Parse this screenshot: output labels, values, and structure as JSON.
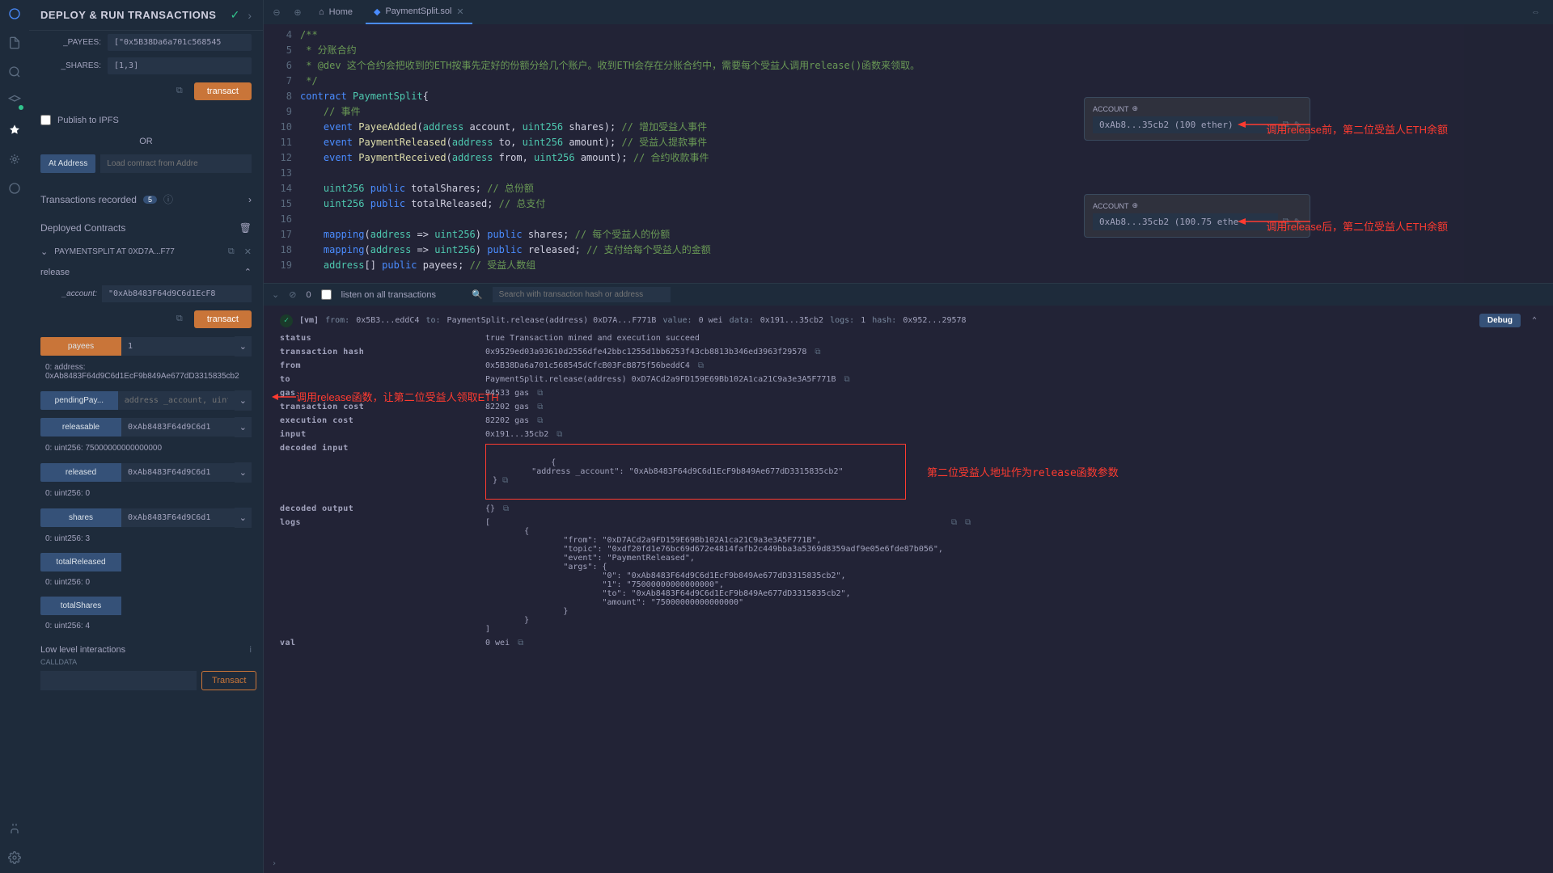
{
  "sidepanel": {
    "title": "DEPLOY & RUN TRANSACTIONS",
    "payees": {
      "label": "_PAYEES:",
      "value": "[\"0x5B38Da6a701c568545"
    },
    "shares": {
      "label": "_SHARES:",
      "value": "[1,3]"
    },
    "transact": "transact",
    "publish": "Publish to IPFS",
    "or": "OR",
    "at_address": "At Address",
    "load_placeholder": "Load contract from Addre",
    "tx_recorded": "Transactions recorded",
    "tx_recorded_count": "5",
    "deployed": "Deployed Contracts",
    "contract_name": "PAYMENTSPLIT AT 0XD7A...F77",
    "release": {
      "name": "release",
      "account_label": "_account:",
      "account_value": "\"0xAb8483F64d9C6d1EcF8",
      "transact": "transact"
    },
    "payees_btn": {
      "label": "payees",
      "val": "1",
      "result": "0:  address: 0xAb8483F64d9C6d1EcF9b849Ae677dD3315835cb2"
    },
    "pendingPay": {
      "label": "pendingPay...",
      "placeholder": "address _account, uint"
    },
    "releasable": {
      "label": "releasable",
      "val": "0xAb8483F64d9C6d1",
      "result": "0: uint256: 75000000000000000"
    },
    "released": {
      "label": "released",
      "val": "0xAb8483F64d9C6d1",
      "result": "0: uint256: 0"
    },
    "shares_btn": {
      "label": "shares",
      "val": "0xAb8483F64d9C6d1",
      "result": "0: uint256: 3"
    },
    "totalReleased": {
      "label": "totalReleased",
      "result": "0: uint256: 0"
    },
    "totalShares": {
      "label": "totalShares",
      "result": "0: uint256: 4"
    },
    "lowlevel": "Low level interactions",
    "calldata": "CALLDATA",
    "transact_outline": "Transact"
  },
  "tabs": {
    "home": "Home",
    "file": "PaymentSplit.sol"
  },
  "code_lines": [
    {
      "n": 4,
      "html": "<span class='cmt'>/**</span>"
    },
    {
      "n": 5,
      "html": "<span class='cmt'> * 分账合约</span>"
    },
    {
      "n": 6,
      "html": "<span class='cmt'> * @dev 这个合约会把收到的ETH按事先定好的份额分给几个账户。收到ETH会存在分账合约中，需要每个受益人调用release()函数来领取。</span>"
    },
    {
      "n": 7,
      "html": "<span class='cmt'> */</span>"
    },
    {
      "n": 8,
      "html": "<span class='kw'>contract</span> <span class='type'>PaymentSplit</span>{"
    },
    {
      "n": 9,
      "html": "    <span class='cmt'>// 事件</span>"
    },
    {
      "n": 10,
      "html": "    <span class='kw'>event</span> <span class='fn'>PayeeAdded</span>(<span class='type'>address</span> account, <span class='type'>uint256</span> shares); <span class='cmt'>// 增加受益人事件</span>"
    },
    {
      "n": 11,
      "html": "    <span class='kw'>event</span> <span class='fn'>PaymentReleased</span>(<span class='type'>address</span> to, <span class='type'>uint256</span> amount); <span class='cmt'>// 受益人提款事件</span>"
    },
    {
      "n": 12,
      "html": "    <span class='kw'>event</span> <span class='fn'>PaymentReceived</span>(<span class='type'>address</span> from, <span class='type'>uint256</span> amount); <span class='cmt'>// 合约收款事件</span>"
    },
    {
      "n": 13,
      "html": ""
    },
    {
      "n": 14,
      "html": "    <span class='type'>uint256</span> <span class='kw'>public</span> totalShares; <span class='cmt'>// 总份额</span>"
    },
    {
      "n": 15,
      "html": "    <span class='type'>uint256</span> <span class='kw'>public</span> totalReleased; <span class='cmt'>// 总支付</span>"
    },
    {
      "n": 16,
      "html": ""
    },
    {
      "n": 17,
      "html": "    <span class='kw'>mapping</span>(<span class='type'>address</span> => <span class='type'>uint256</span>) <span class='kw'>public</span> shares; <span class='cmt'>// 每个受益人的份额</span>"
    },
    {
      "n": 18,
      "html": "    <span class='kw'>mapping</span>(<span class='type'>address</span> => <span class='type'>uint256</span>) <span class='kw'>public</span> released; <span class='cmt'>// 支付给每个受益人的金额</span>"
    },
    {
      "n": 19,
      "html": "    <span class='type'>address</span>[] <span class='kw'>public</span> payees; <span class='cmt'>// 受益人数组</span>"
    }
  ],
  "accounts": {
    "label": "ACCOUNT",
    "before": "0xAb8...35cb2 (100 ether)",
    "after": "0xAb8...35cb2 (100.75 ethe"
  },
  "annotations": {
    "release_call": "调用release函数，让第二位受益人领取ETH",
    "before": "调用release前，第二位受益人ETH余额",
    "after": "调用release后，第二位受益人ETH余额",
    "decoded": "第二位受益人地址作为release函数参数"
  },
  "term_toolbar": {
    "count": "0",
    "listen": "listen on all transactions",
    "search_placeholder": "Search with transaction hash or address"
  },
  "tx": {
    "vm": "[vm]",
    "from_k": "from:",
    "from_v": "0x5B3...eddC4",
    "to_k": "to:",
    "to_v": "PaymentSplit.release(address) 0xD7A...F771B",
    "value_k": "value:",
    "value_v": "0 wei",
    "data_k": "data:",
    "data_v": "0x191...35cb2",
    "logs_k": "logs:",
    "logs_v": "1",
    "hash_k": "hash:",
    "hash_v": "0x952...29578",
    "debug": "Debug"
  },
  "kv": {
    "status": {
      "k": "status",
      "v": "true Transaction mined and execution succeed"
    },
    "txhash": {
      "k": "transaction hash",
      "v": "0x9529ed03a93610d2556dfe42bbc1255d1bb6253f43cb8813b346ed3963f29578"
    },
    "from": {
      "k": "from",
      "v": "0x5B38Da6a701c568545dCfcB03FcB875f56beddC4"
    },
    "to": {
      "k": "to",
      "v": "PaymentSplit.release(address) 0xD7ACd2a9FD159E69Bb102A1ca21C9a3e3A5F771B"
    },
    "gas": {
      "k": "gas",
      "v": "94533 gas"
    },
    "txcost": {
      "k": "transaction cost",
      "v": "82202 gas"
    },
    "execost": {
      "k": "execution cost",
      "v": "82202 gas"
    },
    "input": {
      "k": "input",
      "v": "0x191...35cb2"
    },
    "decinput": {
      "k": "decoded input",
      "v": "{\n        \"address _account\": \"0xAb8483F64d9C6d1EcF9b849Ae677dD3315835cb2\"\n}"
    },
    "decoutput": {
      "k": "decoded output",
      "v": "{}"
    },
    "logs": {
      "k": "logs",
      "v": "[\n        {\n                \"from\": \"0xD7ACd2a9FD159E69Bb102A1ca21C9a3e3A5F771B\",\n                \"topic\": \"0xdf20fd1e76bc69d672e4814fafb2c449bba3a5369d8359adf9e05e6fde87b056\",\n                \"event\": \"PaymentReleased\",\n                \"args\": {\n                        \"0\": \"0xAb8483F64d9C6d1EcF9b849Ae677dD3315835cb2\",\n                        \"1\": \"75000000000000000\",\n                        \"to\": \"0xAb8483F64d9C6d1EcF9b849Ae677dD3315835cb2\",\n                        \"amount\": \"75000000000000000\"\n                }\n        }\n]"
    },
    "val": {
      "k": "val",
      "v": "0 wei"
    }
  }
}
